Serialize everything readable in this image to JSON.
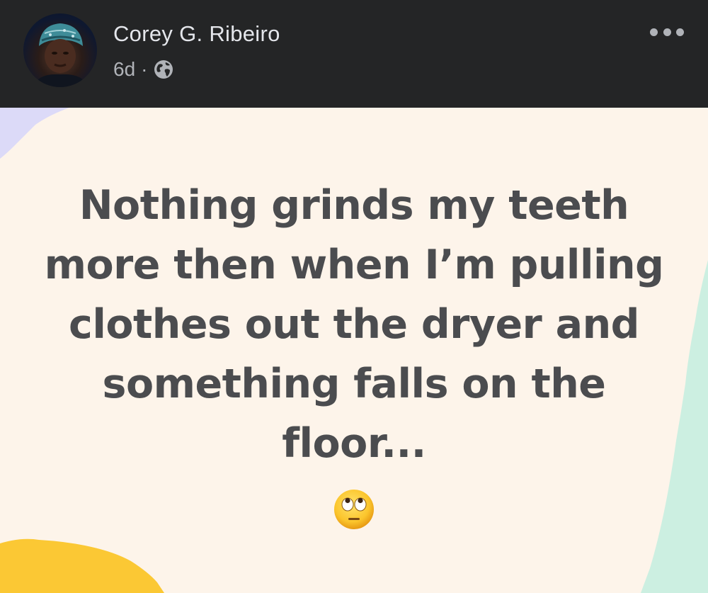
{
  "post": {
    "author_name": "Corey G. Ribeiro",
    "timestamp": "6d",
    "separator": "·",
    "audience_icon": "globe-icon",
    "menu_icon": "more-options-icon",
    "text": "Nothing grinds my teeth more then when I’m pulling clothes out the dryer and something falls on the floor...",
    "emoji_icon": "face-with-rolling-eyes-emoji"
  },
  "colors": {
    "header_bg": "#242526",
    "name_text": "#e4e6eb",
    "meta_text": "#b0b3b8",
    "canvas_bg": "#fdf4ea",
    "post_text": "#4b4c4f",
    "accent_lavender": "#dcdaf8",
    "accent_yellow": "#fbc834",
    "accent_mint": "#ccefe1"
  }
}
